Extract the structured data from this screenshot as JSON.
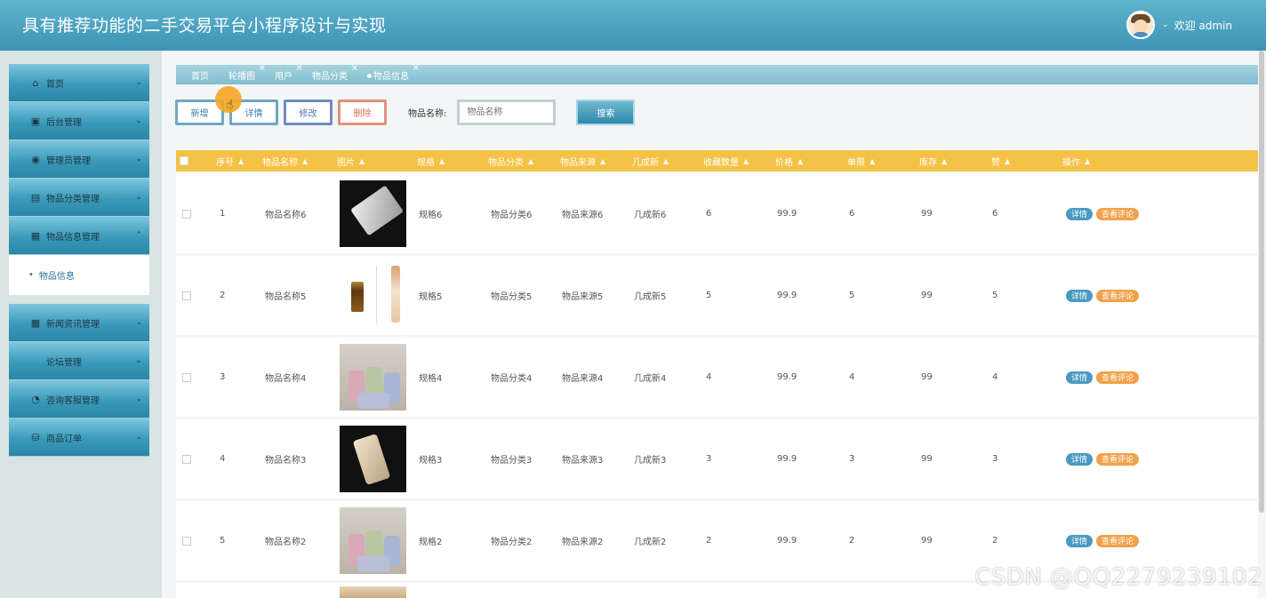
{
  "header": {
    "title": "具有推荐功能的二手交易平台小程序设计与实现",
    "welcome": "欢迎 admin"
  },
  "sidebar": {
    "items": [
      {
        "label": "首页",
        "icon": "home-icon"
      },
      {
        "label": "后台管理",
        "icon": "chip-icon"
      },
      {
        "label": "管理员管理",
        "icon": "circle-dot-icon"
      },
      {
        "label": "物品分类管理",
        "icon": "server-icon"
      },
      {
        "label": "物品信息管理",
        "icon": "grid-icon",
        "expanded": true,
        "submenu": "物品信息"
      },
      {
        "label": "新闻资讯管理",
        "icon": "apps-icon"
      },
      {
        "label": "论坛管理",
        "icon": ""
      },
      {
        "label": "咨询客服管理",
        "icon": "gauge-icon"
      },
      {
        "label": "商品订单",
        "icon": "car-icon"
      }
    ]
  },
  "tabs": [
    "首页",
    "轮播图",
    "用户",
    "物品分类",
    "物品信息"
  ],
  "toolbar": {
    "add": "新增",
    "detail": "详情",
    "edit": "修改",
    "delete": "删除",
    "search_label": "物品名称:",
    "search_placeholder": "物品名称",
    "search_button": "搜索"
  },
  "table": {
    "columns": [
      "序号",
      "物品名称",
      "图片",
      "规格",
      "物品分类",
      "物品来源",
      "几成新",
      "收藏数量",
      "价格",
      "单限",
      "库存",
      "赞",
      "操作"
    ],
    "rows": [
      {
        "no": "1",
        "name": "物品名称6",
        "spec": "规格6",
        "cat": "物品分类6",
        "src": "物品来源6",
        "cond": "几成新6",
        "fav": "6",
        "price": "99.9",
        "limit": "6",
        "stock": "99",
        "like": "6",
        "img": "phone-dark"
      },
      {
        "no": "2",
        "name": "物品名称5",
        "spec": "规格5",
        "cat": "物品分类5",
        "src": "物品来源5",
        "cond": "几成新5",
        "fav": "5",
        "price": "99.9",
        "limit": "5",
        "stock": "99",
        "like": "5",
        "img": "bottles"
      },
      {
        "no": "3",
        "name": "物品名称4",
        "spec": "规格4",
        "cat": "物品分类4",
        "src": "物品来源4",
        "cond": "几成新4",
        "fav": "4",
        "price": "99.9",
        "limit": "4",
        "stock": "99",
        "like": "4",
        "img": "cups"
      },
      {
        "no": "4",
        "name": "物品名称3",
        "spec": "规格3",
        "cat": "物品分类3",
        "src": "物品来源3",
        "cond": "几成新3",
        "fav": "3",
        "price": "99.9",
        "limit": "3",
        "stock": "99",
        "like": "3",
        "img": "phone-gold"
      },
      {
        "no": "5",
        "name": "物品名称2",
        "spec": "规格2",
        "cat": "物品分类2",
        "src": "物品来源2",
        "cond": "几成新2",
        "fav": "2",
        "price": "99.9",
        "limit": "2",
        "stock": "99",
        "like": "2",
        "img": "cups"
      }
    ],
    "action_detail": "详情",
    "action_comments": "查看评论"
  },
  "watermark": "CSDN @QQ2279239102",
  "colors": {
    "header": "#3d93b3",
    "table_header": "#f4c246",
    "accent_orange": "#f2a14a",
    "accent_blue": "#4a9ac0"
  }
}
